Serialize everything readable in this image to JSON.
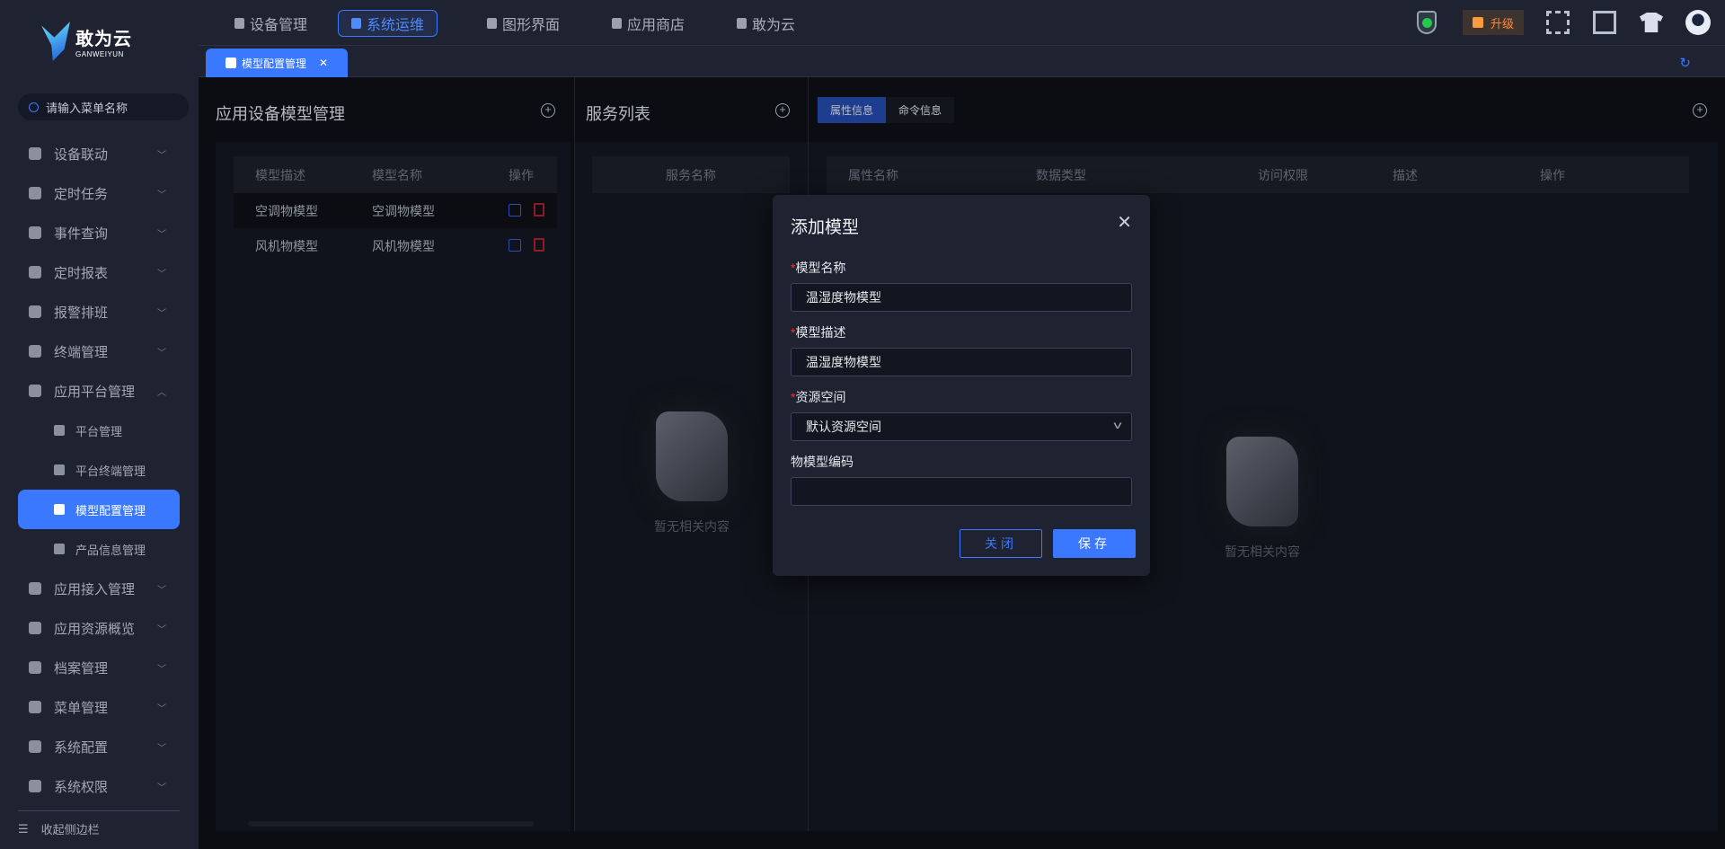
{
  "brand": {
    "name": "敢为云",
    "sub": "GANWEIYUN"
  },
  "sidebar": {
    "search_placeholder": "请输入菜单名称",
    "items": [
      {
        "label": "设备联动",
        "icon": "link-icon"
      },
      {
        "label": "定时任务",
        "icon": "task-icon"
      },
      {
        "label": "事件查询",
        "icon": "event-search-icon"
      },
      {
        "label": "定时报表",
        "icon": "timer-icon"
      },
      {
        "label": "报警排班",
        "icon": "calendar-icon"
      },
      {
        "label": "终端管理",
        "icon": "terminal-icon"
      },
      {
        "label": "应用平台管理",
        "icon": "platform-icon",
        "expanded": true,
        "children": [
          {
            "label": "平台管理"
          },
          {
            "label": "平台终端管理"
          },
          {
            "label": "模型配置管理",
            "active": true
          },
          {
            "label": "产品信息管理"
          }
        ]
      },
      {
        "label": "应用接入管理",
        "icon": "home-icon"
      },
      {
        "label": "应用资源概览",
        "icon": "layers-icon"
      },
      {
        "label": "档案管理",
        "icon": "archive-icon"
      },
      {
        "label": "菜单管理",
        "icon": "menu-icon"
      },
      {
        "label": "系统配置",
        "icon": "home-icon"
      },
      {
        "label": "系统权限",
        "icon": "shield-icon"
      }
    ],
    "collapse_label": "收起侧边栏"
  },
  "topnav": [
    {
      "label": "设备管理"
    },
    {
      "label": "系统运维",
      "active": true
    },
    {
      "label": "图形界面"
    },
    {
      "label": "应用商店"
    },
    {
      "label": "敢为云"
    }
  ],
  "header": {
    "upgrade_label": "升级",
    "colors": {
      "accent": "#3a78ff",
      "upgrade": "#ff8a3d"
    }
  },
  "tabs": [
    {
      "label": "模型配置管理"
    }
  ],
  "model_panel": {
    "title": "应用设备模型管理",
    "columns": [
      "模型描述",
      "模型名称",
      "操作"
    ],
    "rows": [
      {
        "desc": "空调物模型",
        "name": "空调物模型"
      },
      {
        "desc": "风机物模型",
        "name": "风机物模型"
      }
    ]
  },
  "service_panel": {
    "title": "服务列表",
    "columns": [
      "服务名称"
    ],
    "empty": "暂无相关内容"
  },
  "detail_panel": {
    "tabs": [
      "属性信息",
      "命令信息"
    ],
    "columns": [
      "属性名称",
      "数据类型",
      "访问权限",
      "描述",
      "操作"
    ],
    "empty": "暂无相关内容"
  },
  "modal": {
    "title": "添加模型",
    "fields": [
      {
        "label": "模型名称",
        "required": true,
        "value": "温湿度物模型"
      },
      {
        "label": "模型描述",
        "required": true,
        "value": "温湿度物模型"
      },
      {
        "label": "资源空间",
        "required": true,
        "value": "默认资源空间"
      },
      {
        "label": "物模型编码",
        "required": false,
        "value": ""
      }
    ],
    "close_label": "关闭",
    "save_label": "保存"
  }
}
